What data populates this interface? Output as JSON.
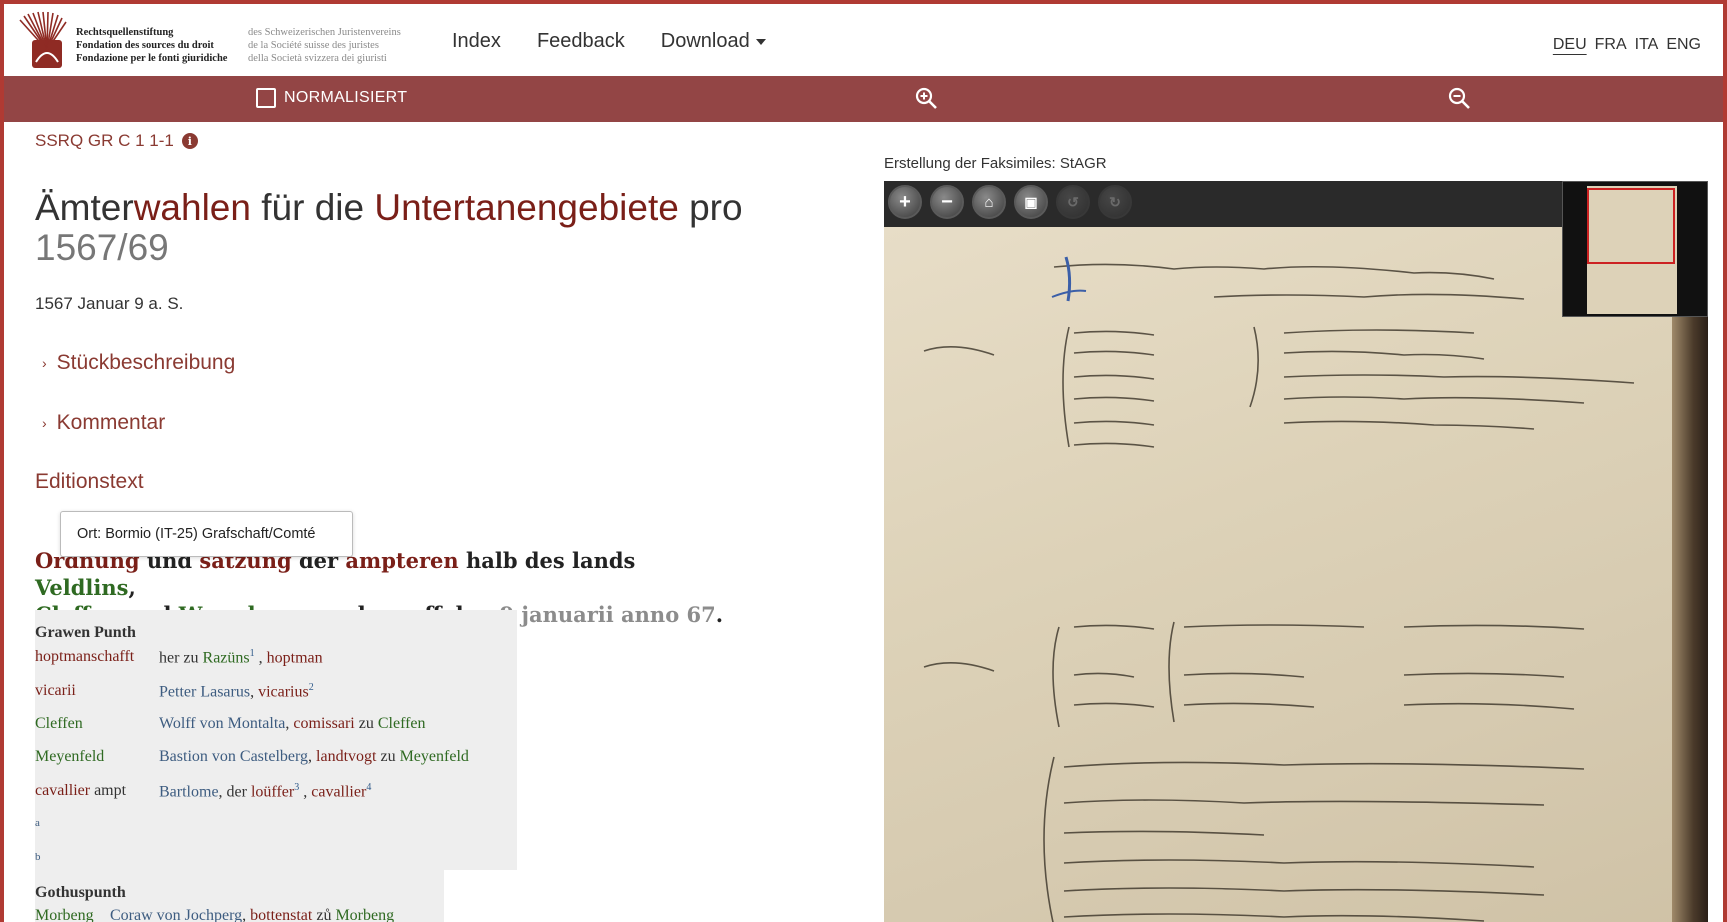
{
  "header": {
    "org_lines": [
      "Rechtsquellenstiftung",
      "Fondation des sources du droit",
      "Fondazione per le fonti giuridiche"
    ],
    "org_lines2": [
      "des Schweizerischen Juristenvereins",
      "de la Société suisse des juristes",
      "della Società svizzera dei giuristi"
    ],
    "nav": {
      "index": "Index",
      "feedback": "Feedback",
      "download": "Download"
    },
    "langs": [
      "DEU",
      "FRA",
      "ITA",
      "ENG"
    ],
    "active_lang": "DEU"
  },
  "toolbar": {
    "normalize_label": "NORMALISIERT"
  },
  "doc": {
    "siglum": "SSRQ GR C 1 1-1",
    "title_parts": [
      "Ämter",
      "wahlen",
      " für die ",
      "Untertanengebiete",
      " pro ",
      "1567/69"
    ],
    "date": "1567 Januar 9 a. S.",
    "sections": [
      "Stückbeschreibung",
      "Kommentar"
    ],
    "edition_heading": "Editionstext",
    "tooltip": "Ort: Bormio (IT-25) Grafschaft/Comté",
    "heading": {
      "w1": "Ordnung",
      "w2": " und ",
      "w3": "satzung",
      "w4": " der ",
      "w5": "ampteren",
      "w6": " halb des lands ",
      "w7": "Veldlins",
      "w8": ",",
      "w9": "Cleffen",
      "w10": " und ",
      "w11": "Wormbs",
      "w12": ", angsehen uff den ",
      "w13": "9 januarii anno 67",
      "w14": "."
    },
    "table1": {
      "head": "Grawen Punth",
      "rows": [
        {
          "k": "hoptmanschafft",
          "v": [
            "her zu ",
            "Razüns",
            "1",
            " , ",
            "hoptman"
          ]
        },
        {
          "k": "vicarii",
          "v": [
            "Petter Lasarus",
            ", ",
            "vicarius",
            "2"
          ]
        },
        {
          "k": "Cleffen",
          "v": [
            "Wolff von Montalta",
            ", ",
            "comissari",
            " zu ",
            "Cleffen"
          ]
        },
        {
          "k": "Meyenfeld",
          "v": [
            "Bastion von Castelberg",
            ", ",
            "landtvogt",
            " zu ",
            "Meyenfeld"
          ]
        },
        {
          "k1": "cavallier",
          "k2": " ampt",
          "v": [
            "Bartlome",
            ", der ",
            "loüffer",
            "3",
            " , ",
            "cavallier",
            "4"
          ]
        }
      ],
      "notes": [
        "a",
        "b"
      ]
    },
    "table2": {
      "head": "Gothuspunth",
      "row": {
        "k": "Morbeng",
        "v": [
          "Coraw von Jochperg",
          ", ",
          "bottenstat",
          " zů ",
          "Morbeng"
        ]
      }
    }
  },
  "facsimile": {
    "label": "Erstellung der Faksimiles: StAGR",
    "controls": [
      "zoom-in",
      "zoom-out",
      "home",
      "fullscreen",
      "rotate-left",
      "rotate-right"
    ]
  },
  "colors": {
    "accent": "#934545",
    "red_term": "#7a1f18",
    "green_place": "#2f6a22",
    "blue_person": "#3d5c80"
  }
}
